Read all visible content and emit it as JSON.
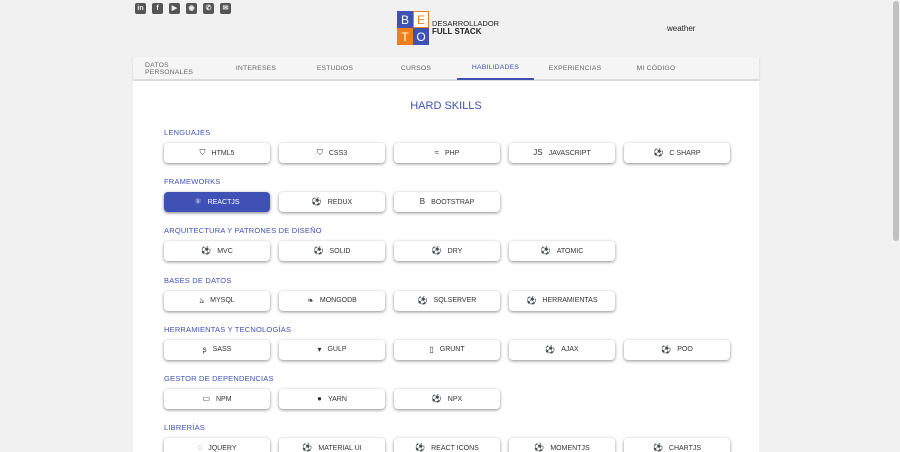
{
  "social": [
    {
      "name": "linkedin-icon",
      "glyph": "in"
    },
    {
      "name": "facebook-icon",
      "glyph": "f"
    },
    {
      "name": "youtube-icon",
      "glyph": "▶"
    },
    {
      "name": "github-icon",
      "glyph": "◉"
    },
    {
      "name": "whatsapp-icon",
      "glyph": "✆"
    },
    {
      "name": "email-icon",
      "glyph": "✉"
    }
  ],
  "logo": {
    "letters": [
      "B",
      "E",
      "T",
      "O"
    ],
    "line1": "DESARROLLADOR",
    "line2": "FULL STACK"
  },
  "weather": "weather",
  "tabs": [
    {
      "label": "DATOS PERSONALES",
      "active": false
    },
    {
      "label": "INTERESES",
      "active": false
    },
    {
      "label": "ESTUDIOS",
      "active": false
    },
    {
      "label": "CURSOS",
      "active": false
    },
    {
      "label": "HABILIDADES",
      "active": true
    },
    {
      "label": "EXPERIENCIAS",
      "active": false
    },
    {
      "label": "MI CÓDIGO",
      "active": false
    }
  ],
  "title": "HARD SKILLS",
  "sections": [
    {
      "title": "LENGUAJES",
      "items": [
        {
          "label": "HTML5",
          "icon": "html5-icon",
          "glyph": "⛉"
        },
        {
          "label": "CSS3",
          "icon": "css3-icon",
          "glyph": "⛉"
        },
        {
          "label": "PHP",
          "icon": "php-icon",
          "glyph": "≈"
        },
        {
          "label": "JAVASCRIPT",
          "icon": "javascript-icon",
          "glyph": "JS"
        },
        {
          "label": "C SHARP",
          "icon": "soccer-ball-icon",
          "glyph": "⚽"
        }
      ]
    },
    {
      "title": "FRAMEWORKS",
      "items": [
        {
          "label": "REACTJS",
          "icon": "react-icon",
          "glyph": "⚛",
          "active": true
        },
        {
          "label": "REDUX",
          "icon": "soccer-ball-icon",
          "glyph": "⚽"
        },
        {
          "label": "BOOTSTRAP",
          "icon": "bootstrap-icon",
          "glyph": "B"
        }
      ]
    },
    {
      "title": "ARQUITECTURA Y PATRONES DE DISEÑO",
      "items": [
        {
          "label": "MVC",
          "icon": "soccer-ball-icon",
          "glyph": "⚽"
        },
        {
          "label": "SOLID",
          "icon": "soccer-ball-icon",
          "glyph": "⚽"
        },
        {
          "label": "DRY",
          "icon": "soccer-ball-icon",
          "glyph": "⚽"
        },
        {
          "label": "ATOMIC",
          "icon": "soccer-ball-icon",
          "glyph": "⚽"
        }
      ]
    },
    {
      "title": "BASES DE DATOS",
      "items": [
        {
          "label": "MYSQL",
          "icon": "mysql-icon",
          "glyph": "ঌ"
        },
        {
          "label": "MONGODB",
          "icon": "mongodb-icon",
          "glyph": "❧"
        },
        {
          "label": "SQLSERVER",
          "icon": "soccer-ball-icon",
          "glyph": "⚽"
        },
        {
          "label": "HERRAMIENTAS",
          "icon": "soccer-ball-icon",
          "glyph": "⚽"
        }
      ]
    },
    {
      "title": "HERRAMIENTAS Y TECNOLOGÍAS",
      "items": [
        {
          "label": "SASS",
          "icon": "sass-icon",
          "glyph": "ʂ"
        },
        {
          "label": "GULP",
          "icon": "gulp-icon",
          "glyph": "▾"
        },
        {
          "label": "GRUNT",
          "icon": "grunt-icon",
          "glyph": "▯"
        },
        {
          "label": "AJAX",
          "icon": "soccer-ball-icon",
          "glyph": "⚽"
        },
        {
          "label": "POO",
          "icon": "soccer-ball-icon",
          "glyph": "⚽"
        }
      ]
    },
    {
      "title": "GESTOR DE DEPENDENCIAS",
      "items": [
        {
          "label": "NPM",
          "icon": "npm-icon",
          "glyph": "▭"
        },
        {
          "label": "YARN",
          "icon": "yarn-icon",
          "glyph": "●"
        },
        {
          "label": "NPX",
          "icon": "soccer-ball-icon",
          "glyph": "⚽"
        }
      ]
    },
    {
      "title": "LIBRERÍAS",
      "items": [
        {
          "label": "JQUERY",
          "icon": "jquery-icon",
          "glyph": "◌"
        },
        {
          "label": "MATERIAL UI",
          "icon": "soccer-ball-icon",
          "glyph": "⚽"
        },
        {
          "label": "REACT ICONS",
          "icon": "soccer-ball-icon",
          "glyph": "⚽"
        },
        {
          "label": "MOMENTJS",
          "icon": "soccer-ball-icon",
          "glyph": "⚽"
        },
        {
          "label": "CHARTJS",
          "icon": "soccer-ball-icon",
          "glyph": "⚽"
        }
      ]
    }
  ],
  "colors": {
    "accent": "#3f51b5",
    "logo_orange": "#ef7f1a"
  }
}
